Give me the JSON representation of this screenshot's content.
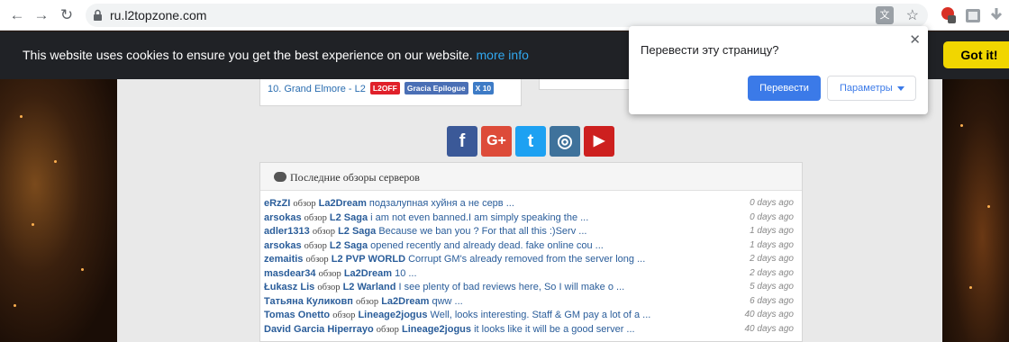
{
  "browser": {
    "url": "ru.l2topzone.com",
    "back_icon": "←",
    "forward_icon": "→",
    "reload_icon": "↻",
    "star_icon": "☆"
  },
  "cookie_banner": {
    "text": "This website uses cookies to ensure you get the best experience on our website.",
    "link_label": "more info",
    "accept_label": "Got it!"
  },
  "top_list": {
    "row_text": "10. Grand Elmore - L2",
    "badges": [
      "L2OFF",
      "Gracia Epilogue",
      "X 10"
    ]
  },
  "social": [
    {
      "name": "facebook",
      "glyph": "f",
      "color": "#3b5998"
    },
    {
      "name": "google-plus",
      "glyph": "G+",
      "color": "#dd4b39"
    },
    {
      "name": "twitter",
      "glyph": "t",
      "color": "#1da1f2"
    },
    {
      "name": "instagram",
      "glyph": "◎",
      "color": "#3f729b"
    },
    {
      "name": "youtube",
      "glyph": "▶",
      "color": "#cd201f"
    }
  ],
  "reviews": {
    "title": "Последние обзоры серверов",
    "connector": "обзор",
    "items": [
      {
        "user": "eRzZI",
        "server": "La2Dream",
        "text": "подзалупная хуйня а не серв ...",
        "age": "0 days ago"
      },
      {
        "user": "arsokas",
        "server": "L2 Saga",
        "text": "i am not even banned.I am simply speaking the ...",
        "age": "0 days ago"
      },
      {
        "user": "adler1313",
        "server": "L2 Saga",
        "text": "Because we ban you ? For that all this :)Serv ...",
        "age": "1 days ago"
      },
      {
        "user": "arsokas",
        "server": "L2 Saga",
        "text": "opened recently and already dead. fake online cou ...",
        "age": "1 days ago"
      },
      {
        "user": "zemaitis",
        "server": "L2 PVP WORLD",
        "text": "Corrupt GM's already removed from the server long ...",
        "age": "2 days ago"
      },
      {
        "user": "masdear34",
        "server": "La2Dream",
        "text": "10 ...",
        "age": "2 days ago"
      },
      {
        "user": "Łukasz Lis",
        "server": "L2 Warland",
        "text": "I see plenty of bad reviews here, So I will make o ...",
        "age": "5 days ago"
      },
      {
        "user": "Татьяна Куликовп",
        "server": "La2Dream",
        "text": "qww ...",
        "age": "6 days ago"
      },
      {
        "user": "Tomas Onetto",
        "server": "Lineage2jogus",
        "text": "Well, looks interesting. Staff & GM pay a lot of a ...",
        "age": "40 days ago"
      },
      {
        "user": "David Garcia Hiperrayo",
        "server": "Lineage2jogus",
        "text": "it looks like it will be a good server ...",
        "age": "40 days ago"
      }
    ]
  },
  "translate_popup": {
    "title": "Перевести эту страницу?",
    "close_icon": "✕",
    "translate_label": "Перевести",
    "options_label": "Параметры"
  }
}
